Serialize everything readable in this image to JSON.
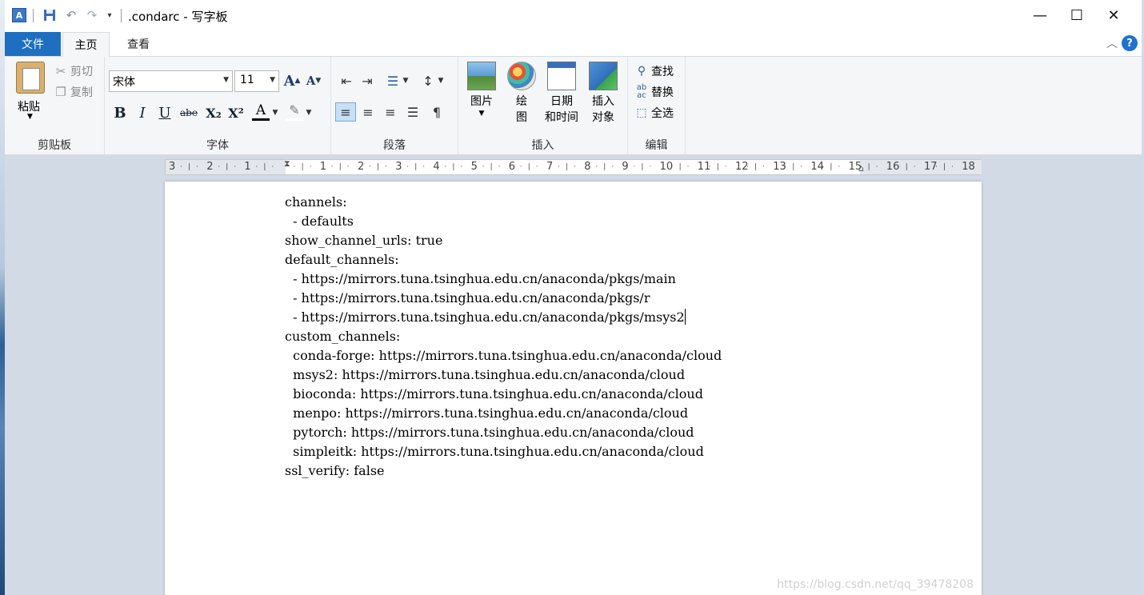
{
  "titlebar": {
    "title": ".condarc - 写字板",
    "app_icon": "wordpad-icon",
    "quick_access": [
      "save-icon",
      "undo-icon",
      "redo-icon",
      "customize-dropdown-icon"
    ],
    "minimize": "—",
    "maximize": "☐",
    "close": "✕"
  },
  "tabs": {
    "file": "文件",
    "home": "主页",
    "view": "查看"
  },
  "ribbon": {
    "clipboard": {
      "label": "剪贴板",
      "paste": "粘贴",
      "cut": "剪切",
      "copy": "复制"
    },
    "font": {
      "label": "字体",
      "family": "宋体",
      "size": "11",
      "grow": "A",
      "shrink": "A",
      "bold": "B",
      "italic": "I",
      "underline": "U",
      "strike": "abe",
      "subscript": "X₂",
      "superscript": "X²",
      "color": "A"
    },
    "paragraph": {
      "label": "段落"
    },
    "insert": {
      "label": "插入",
      "picture": "图片",
      "paint_1": "绘",
      "paint_2": "图",
      "datetime_1": "日期",
      "datetime_2": "和时间",
      "object_1": "插入",
      "object_2": "对象"
    },
    "editing": {
      "label": "编辑",
      "find": "查找",
      "replace": "替换",
      "select_all": "全选"
    }
  },
  "ruler": {
    "ticks": [
      "3",
      "2",
      "1",
      "",
      "1",
      "2",
      "3",
      "4",
      "5",
      "6",
      "7",
      "8",
      "9",
      "10",
      "11",
      "12",
      "13",
      "14",
      "15",
      "16",
      "17",
      "18"
    ]
  },
  "document": {
    "lines": [
      "channels:",
      "  - defaults",
      "show_channel_urls: true",
      "default_channels:",
      "  - https://mirrors.tuna.tsinghua.edu.cn/anaconda/pkgs/main",
      "  - https://mirrors.tuna.tsinghua.edu.cn/anaconda/pkgs/r",
      "  - https://mirrors.tuna.tsinghua.edu.cn/anaconda/pkgs/msys2",
      "custom_channels:",
      "  conda-forge: https://mirrors.tuna.tsinghua.edu.cn/anaconda/cloud",
      "  msys2: https://mirrors.tuna.tsinghua.edu.cn/anaconda/cloud",
      "  bioconda: https://mirrors.tuna.tsinghua.edu.cn/anaconda/cloud",
      "  menpo: https://mirrors.tuna.tsinghua.edu.cn/anaconda/cloud",
      "  pytorch: https://mirrors.tuna.tsinghua.edu.cn/anaconda/cloud",
      "  simpleitk: https://mirrors.tuna.tsinghua.edu.cn/anaconda/cloud",
      "ssl_verify: false"
    ],
    "watermark": "https://blog.csdn.net/qq_39478208"
  },
  "colors": {
    "file_tab": "#1e6fc0",
    "ribbon_bg": "#f5f6f7",
    "doc_bg": "#d2dae6"
  }
}
